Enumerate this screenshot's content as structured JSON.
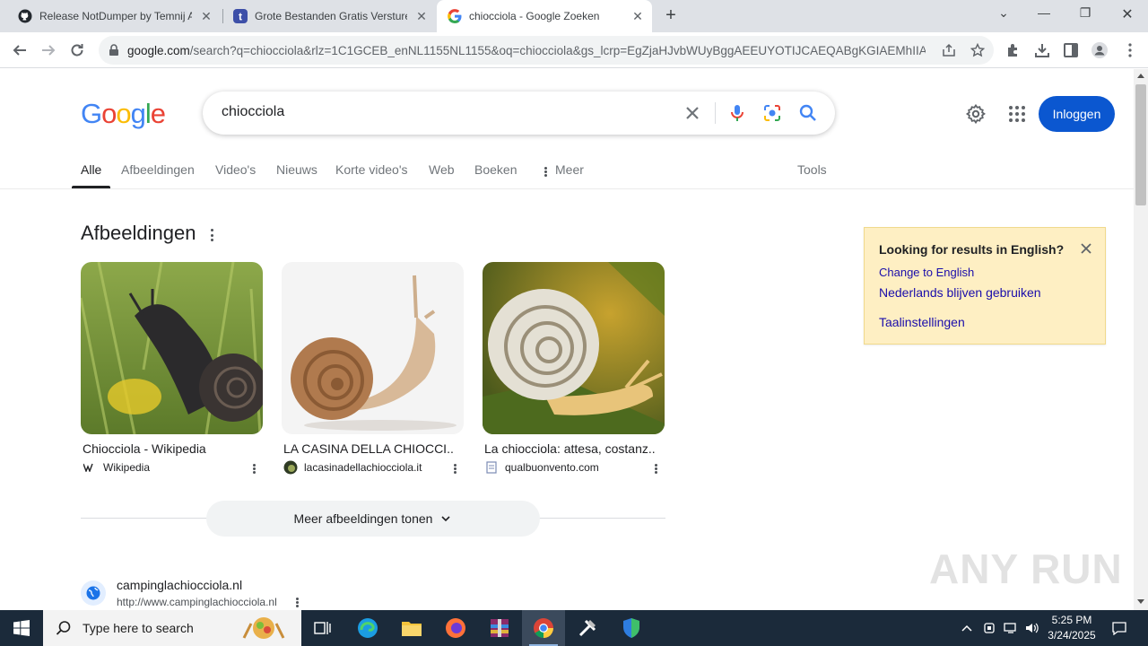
{
  "browser": {
    "tabs": [
      {
        "title": "Release NotDumper by Temnij A",
        "icon": "github-icon",
        "active": false
      },
      {
        "title": "Grote Bestanden Gratis Versturen",
        "icon": "transfer-icon",
        "active": false
      },
      {
        "title": "chiocciola - Google Zoeken",
        "icon": "google-icon",
        "active": true
      }
    ],
    "url_host": "google.com",
    "url_rest": "/search?q=chiocciola&rlz=1C1GCEB_enNL1155NL1155&oq=chiocciola&gs_lcrp=EgZjaHJvbWUyBggAEEUYOTIJCAEQABgKGIAEMhIIAh..."
  },
  "google": {
    "logo": [
      "G",
      "o",
      "o",
      "g",
      "l",
      "e"
    ],
    "logo_colors": [
      "#4285f4",
      "#ea4335",
      "#fbbc05",
      "#4285f4",
      "#34a853",
      "#ea4335"
    ],
    "query": "chiocciola",
    "signin_label": "Inloggen",
    "search_tabs": [
      "Alle",
      "Afbeeldingen",
      "Video's",
      "Nieuws",
      "Korte video's",
      "Web",
      "Boeken",
      "Meer"
    ],
    "tools_label": "Tools",
    "images_heading": "Afbeeldingen",
    "image_cards": [
      {
        "title": "Chiocciola - Wikipedia",
        "source": "Wikipedia",
        "fav_icon": "wikipedia-icon"
      },
      {
        "title": "LA CASINA DELLA CHIOCCI...",
        "source": "lacasinadellachiocciola.it",
        "fav_icon": "site-icon"
      },
      {
        "title": "La chiocciola: attesa, costanz...",
        "source": "qualbuonvento.com",
        "fav_icon": "site-icon"
      }
    ],
    "more_images_label": "Meer afbeeldingen tonen",
    "result": {
      "site": "campinglachiocciola.nl",
      "url": "http://www.campinglachiocciola.nl"
    },
    "lang_panel": {
      "title": "Looking for results in English?",
      "link1": "Change to English",
      "link2": "Nederlands blijven gebruiken",
      "link3": "Taalinstellingen"
    },
    "watermark": "ANY RUN"
  },
  "taskbar": {
    "search_placeholder": "Type here to search",
    "time": "5:25 PM",
    "date": "3/24/2025"
  },
  "colors": {
    "accent": "#0b57d0",
    "link": "#1a0dab",
    "panel_bg": "#feefc3",
    "taskbar": "#1b2a3a"
  }
}
